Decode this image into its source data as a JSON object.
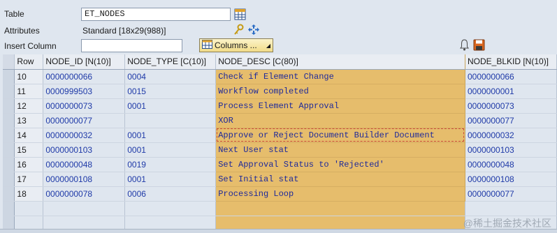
{
  "header": {
    "table_label": "Table",
    "table_value": "ET_NODES",
    "attributes_label": "Attributes",
    "attributes_value": "Standard [18x29(988)]",
    "insert_column_label": "Insert Column",
    "insert_column_value": "",
    "columns_button_label": "Columns ..."
  },
  "grid": {
    "columns": [
      "Row",
      "NODE_ID [N(10)]",
      "NODE_TYPE [C(10)]",
      "NODE_DESC [C(80)]",
      "NODE_BLKID [N(10)]"
    ],
    "rows": [
      {
        "row": "10",
        "node_id": "0000000066",
        "node_type": "0004",
        "node_desc": "Check if Element Change",
        "node_blkid": "0000000066"
      },
      {
        "row": "11",
        "node_id": "0000999503",
        "node_type": "0015",
        "node_desc": "Workflow completed",
        "node_blkid": "0000000001"
      },
      {
        "row": "12",
        "node_id": "0000000073",
        "node_type": "0001",
        "node_desc": "Process Element Approval",
        "node_blkid": "0000000073"
      },
      {
        "row": "13",
        "node_id": "0000000077",
        "node_type": "",
        "node_desc": "XOR",
        "node_blkid": "0000000077"
      },
      {
        "row": "14",
        "node_id": "0000000032",
        "node_type": "0001",
        "node_desc": "Approve or Reject Document Builder Document",
        "node_blkid": "0000000032"
      },
      {
        "row": "15",
        "node_id": "0000000103",
        "node_type": "0001",
        "node_desc": "Next User stat",
        "node_blkid": "0000000103"
      },
      {
        "row": "16",
        "node_id": "0000000048",
        "node_type": "0019",
        "node_desc": "Set Approval Status to 'Rejected'",
        "node_blkid": "0000000048"
      },
      {
        "row": "17",
        "node_id": "0000000108",
        "node_type": "0001",
        "node_desc": "Set Initial stat",
        "node_blkid": "0000000108"
      },
      {
        "row": "18",
        "node_id": "0000000078",
        "node_type": "0006",
        "node_desc": "Processing Loop",
        "node_blkid": "0000000077"
      }
    ]
  },
  "watermark": "@稀土掘金技术社区",
  "colors": {
    "background": "#dfe6ef",
    "highlight_column": "#e6bd6c",
    "value_text": "#1f3aa8"
  },
  "icons": {
    "table_picker": "table-grid-icon",
    "attributes_key": "key-icon",
    "attributes_arrows": "move-arrows-icon",
    "columns": "columns-table-icon",
    "tools": "bell-icon",
    "save": "save-disk-icon"
  }
}
